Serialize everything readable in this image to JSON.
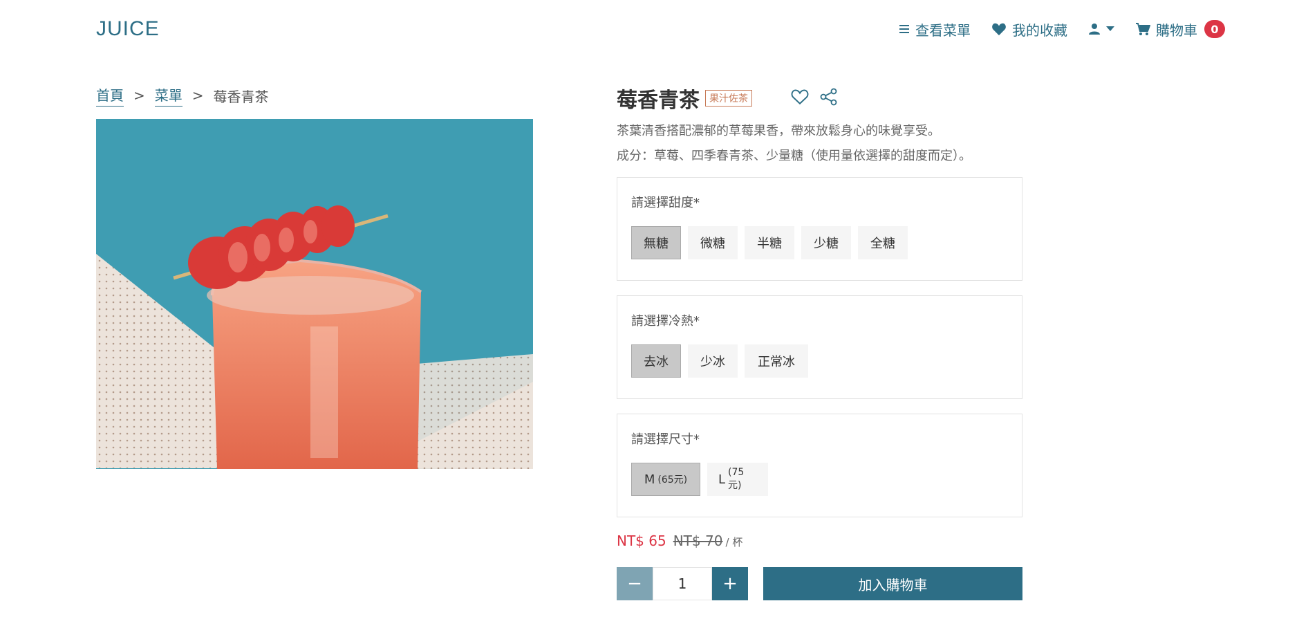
{
  "brand": {
    "logo": "JUICE"
  },
  "nav": {
    "menu": "查看菜單",
    "favorites": "我的收藏",
    "cart": "購物車",
    "cart_count": "0"
  },
  "breadcrumb": {
    "home": "首頁",
    "sep": ">",
    "menu": "菜單",
    "current": "莓香青茶"
  },
  "product": {
    "title": "莓香青茶",
    "tag": "果汁佐茶",
    "description": "茶葉清香搭配濃郁的草莓果香，帶來放鬆身心的味覺享受。",
    "ingredients": "成分：草莓、四季春青茶、少量糖（使用量依選擇的甜度而定）。",
    "image_icon": "strawberry-juice-photo"
  },
  "sweetness": {
    "label": "請選擇甜度*",
    "options": [
      "無糖",
      "微糖",
      "半糖",
      "少糖",
      "全糖"
    ],
    "selected": "無糖"
  },
  "temperature": {
    "label": "請選擇冷熱*",
    "options": [
      "去冰",
      "少冰",
      "正常冰"
    ],
    "selected": "去冰"
  },
  "size": {
    "label": "請選擇尺寸*",
    "options": [
      {
        "name": "M",
        "price": "(65元)"
      },
      {
        "name": "L",
        "price": "(75元)"
      }
    ],
    "selected": "M"
  },
  "pricing": {
    "price": "NT$ 65",
    "old_price": "NT$ 70",
    "unit": "/ 杯"
  },
  "quantity": {
    "minus": "−",
    "value": "1",
    "plus": "+"
  },
  "actions": {
    "add_to_cart": "加入購物車"
  },
  "colors": {
    "brand": "#2d6e86",
    "price": "#dc3545",
    "tag": "#c77a57",
    "badge": "#dc3545"
  }
}
